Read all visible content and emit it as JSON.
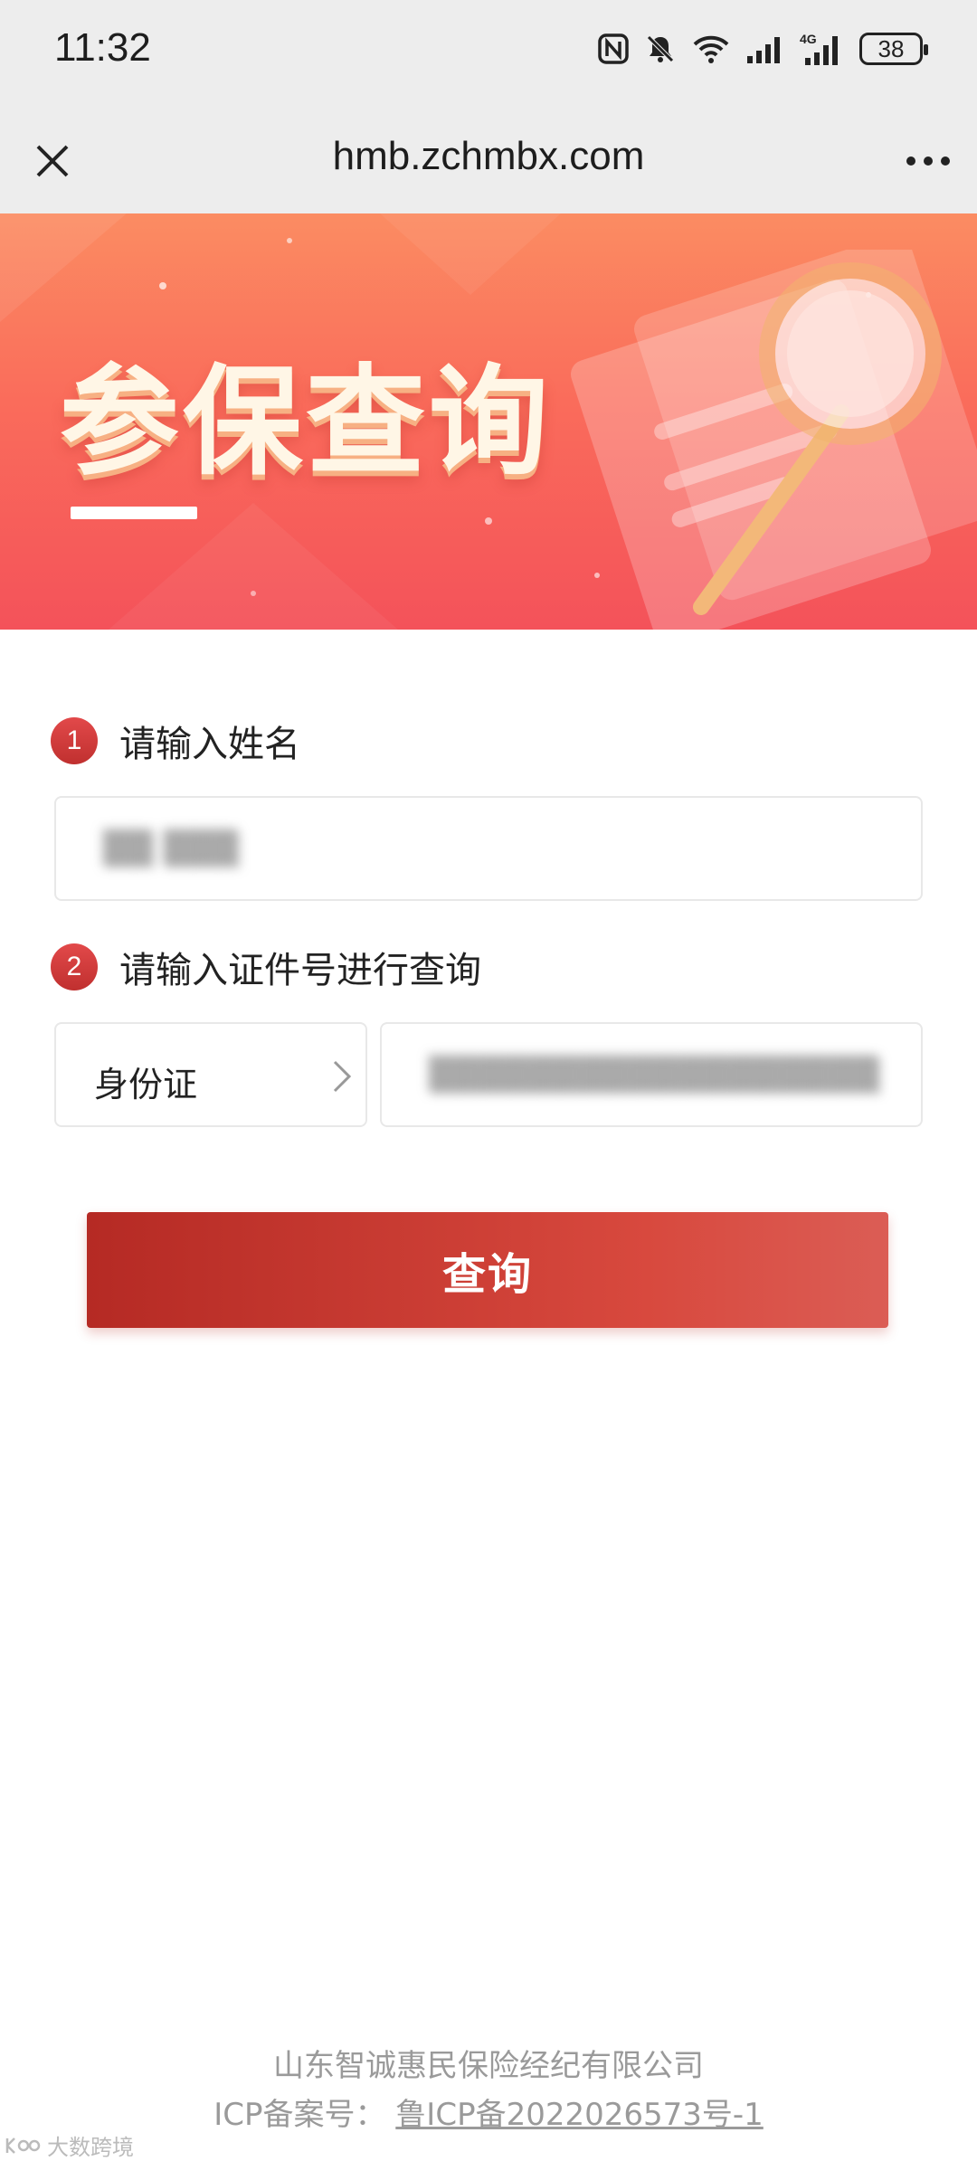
{
  "status_bar": {
    "time": "11:32",
    "battery": "38",
    "icons": [
      "nfc-icon",
      "mute-bell-icon",
      "wifi-icon",
      "signal-icon",
      "4g-signal-icon",
      "battery-icon"
    ],
    "network_label": "4G"
  },
  "title_bar": {
    "url": "hmb.zchmbx.com",
    "close_icon": "close-icon",
    "more_icon": "more-icon"
  },
  "banner": {
    "title": "参保查询",
    "art_icon": "magnifier-icon"
  },
  "form": {
    "step1": {
      "number": "1",
      "label": "请输入姓名",
      "value": "▒▒ ▒▒▒"
    },
    "step2": {
      "number": "2",
      "label": "请输入证件号进行查询"
    },
    "id_type": "身份证",
    "id_number_value": "▒▒▒▒▒▒▒▒▒▒▒▒▒▒▒▒▒▒",
    "submit_label": "查询"
  },
  "footer": {
    "company": "山东智诚惠民保险经纪有限公司",
    "icp_prefix": "ICP备案号：",
    "icp_number": "鲁ICP备2022026573号-1"
  },
  "watermark": "大数跨境",
  "colors": {
    "primary_red": "#c0302f",
    "banner_top": "#fb8c62",
    "banner_bottom": "#f4525a",
    "chrome_bg": "#ededed"
  }
}
